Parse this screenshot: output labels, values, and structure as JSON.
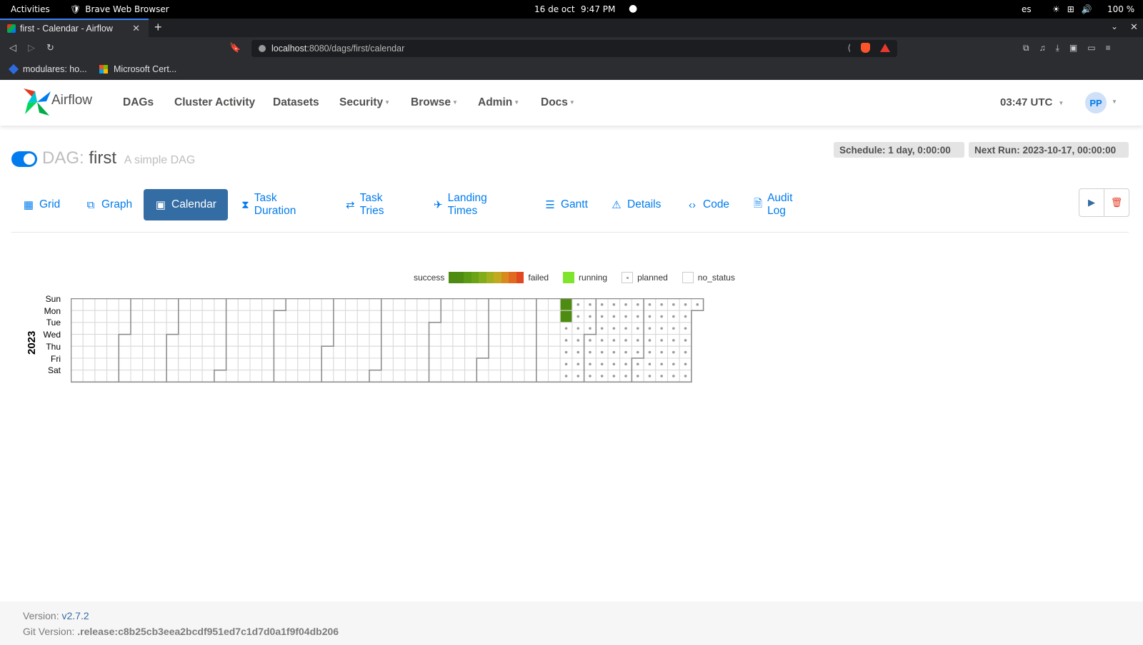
{
  "os": {
    "activities": "Activities",
    "app": "Brave Web Browser",
    "date": "16 de oct",
    "time": "9:47 PM",
    "lang": "es",
    "battery": "100 %"
  },
  "browser": {
    "tab_title": "first - Calendar - Airflow",
    "url_host": "localhost",
    "url_path": ":8080/dags/first/calendar",
    "bookmarks": [
      "modulares: ho...",
      "Microsoft Cert..."
    ]
  },
  "airflow_nav": {
    "brand": "Airflow",
    "menu": {
      "dags": "DAGs",
      "cluster_activity": "Cluster Activity",
      "datasets": "Datasets",
      "security": "Security",
      "browse": "Browse",
      "admin": "Admin",
      "docs": "Docs"
    },
    "time": "03:47 UTC",
    "avatar": "PP"
  },
  "dag": {
    "prefix": "DAG:",
    "name": "first",
    "description": "A simple DAG",
    "paused": false,
    "schedule": "Schedule: 1 day, 0:00:00",
    "next_run": "Next Run: 2023-10-17, 00:00:00"
  },
  "view_tabs": {
    "grid": "Grid",
    "graph": "Graph",
    "calendar": "Calendar",
    "task_duration": "Task Duration",
    "task_tries": "Task Tries",
    "landing_times": "Landing Times",
    "gantt": "Gantt",
    "details": "Details",
    "code": "Code",
    "audit_log": "Audit Log"
  },
  "legend": {
    "success": "success",
    "failed": "failed",
    "running": "running",
    "planned": "planned",
    "no_status": "no_status",
    "scale_colors": [
      "#4d8c11",
      "#4d8c11",
      "#5a9a14",
      "#6aa416",
      "#82ac1a",
      "#a2b01e",
      "#c2a91f",
      "#d98a1f",
      "#e06a1f",
      "#e0491f"
    ],
    "running_color": "#7fe52c"
  },
  "calendar": {
    "year": "2023",
    "days": [
      "Sun",
      "Mon",
      "Tue",
      "Wed",
      "Thu",
      "Fri",
      "Sat"
    ],
    "year_start_weekday": 0,
    "success_dates": [
      "2023-10-15",
      "2023-10-16"
    ],
    "planned_from": "2023-10-17",
    "success_color": "#4d8c11"
  },
  "footer": {
    "version_label": "Version:",
    "version": "v2.7.2",
    "git_label": "Git Version:",
    "git": ".release:c8b25cb3eea2bcdf951ed7c1d7d0a1f9f04db206"
  }
}
